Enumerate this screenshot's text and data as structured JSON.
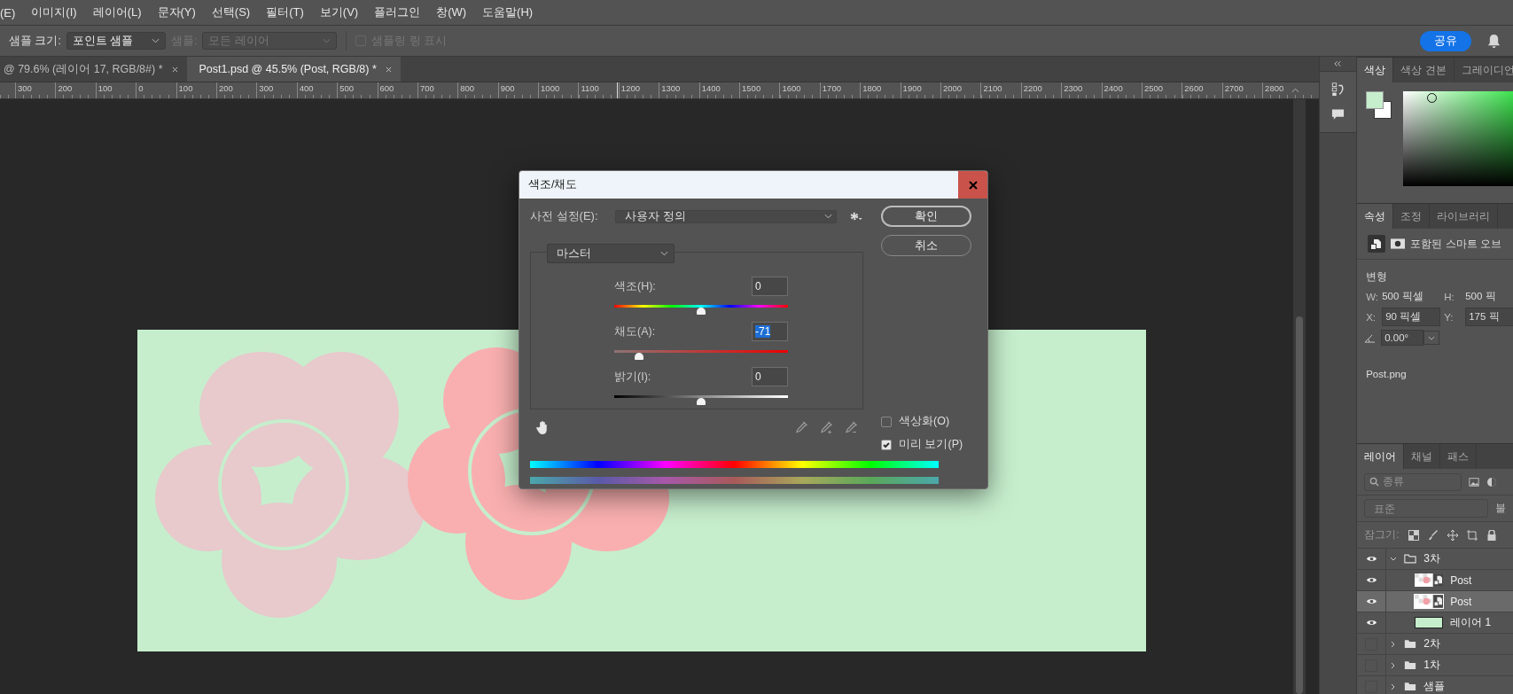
{
  "menu": [
    "(E)",
    "이미지(I)",
    "레이어(L)",
    "문자(Y)",
    "선택(S)",
    "필터(T)",
    "보기(V)",
    "플러그인",
    "창(W)",
    "도움말(H)"
  ],
  "options_bar": {
    "size_label": "샘플 크기:",
    "size_value": "포인트 샘플",
    "sample_label": "샘플:",
    "sample_value": "모든 레이어",
    "sample_disabled": true,
    "ring_label": "샘플링 링 표시",
    "ring_checked": false,
    "ring_disabled": true,
    "share": "공유"
  },
  "doc_tabs": [
    {
      "label": "@ 79.6% (레이어 17, RGB/8#) *",
      "selected": false
    },
    {
      "label": "Post1.psd @ 45.5% (Post, RGB/8) *",
      "selected": true
    }
  ],
  "ruler": [
    "300",
    "200",
    "100",
    "0",
    "100",
    "200",
    "300",
    "400",
    "500",
    "600",
    "700",
    "800",
    "900",
    "1000",
    "1100",
    "1200",
    "1300",
    "1400",
    "1500",
    "1600",
    "1700",
    "1800",
    "1900",
    "2000",
    "2100",
    "2200",
    "2300",
    "2400",
    "2500",
    "2600",
    "2700",
    "2800"
  ],
  "dialog": {
    "title": "색조/채도",
    "preset_label": "사전 설정(E):",
    "preset_value": "사용자 정의",
    "ok": "확인",
    "cancel": "취소",
    "channel": "마스터",
    "sliders": [
      {
        "kind": "hue",
        "label": "색조(H):",
        "value": "0",
        "highlighted": false,
        "level": 0.5
      },
      {
        "kind": "saturation",
        "label": "채도(A):",
        "value": "-71",
        "highlighted": true,
        "level": 0.145
      },
      {
        "kind": "lightness",
        "label": "밝기(I):",
        "value": "0",
        "highlighted": false,
        "level": 0.5
      }
    ],
    "colorize": {
      "label": "색상화(O)",
      "checked": false
    },
    "preview": {
      "label": "미리 보기(P)",
      "checked": true
    }
  },
  "color_panel": {
    "tabs": [
      {
        "label": "색상",
        "selected": true
      },
      {
        "label": "색상 견본",
        "selected": false
      },
      {
        "label": "그레이디언",
        "selected": false
      }
    ]
  },
  "properties_panel": {
    "tabs": [
      {
        "label": "속성",
        "selected": true
      },
      {
        "label": "조정",
        "selected": false
      },
      {
        "label": "라이브러리",
        "selected": false
      }
    ],
    "object_type": "포함된 스마트 오브",
    "section": "변형",
    "w_label": "W:",
    "w_value": "500 픽셀",
    "h_label": "H:",
    "h_value": "500 픽",
    "x_label": "X:",
    "x_value": "90 픽셀",
    "y_label": "Y:",
    "y_value": "175 픽",
    "angle": "0.00°",
    "file": "Post.png"
  },
  "layers_panel": {
    "tabs": [
      {
        "label": "레이어",
        "selected": true
      },
      {
        "label": "채널",
        "selected": false
      },
      {
        "label": "패스",
        "selected": false
      }
    ],
    "filter_placeholder": "종류",
    "blend_mode": "표준",
    "opacity_label": "불",
    "lock_label": "잠그기:",
    "layers": [
      {
        "kind": "group",
        "name": "3차",
        "visible": true,
        "expanded": true,
        "selected": false,
        "children": [
          {
            "kind": "smart",
            "name": "Post",
            "visible": true,
            "selected": false
          },
          {
            "kind": "smart",
            "name": "Post",
            "visible": true,
            "selected": true
          },
          {
            "kind": "fill",
            "name": "레이어 1",
            "visible": true,
            "selected": false
          }
        ]
      },
      {
        "kind": "group",
        "name": "2차",
        "visible": false,
        "expanded": false,
        "selected": false
      },
      {
        "kind": "group",
        "name": "1차",
        "visible": false,
        "expanded": false,
        "selected": false
      },
      {
        "kind": "group",
        "name": "샘플",
        "visible": false,
        "expanded": false,
        "selected": false
      }
    ]
  }
}
